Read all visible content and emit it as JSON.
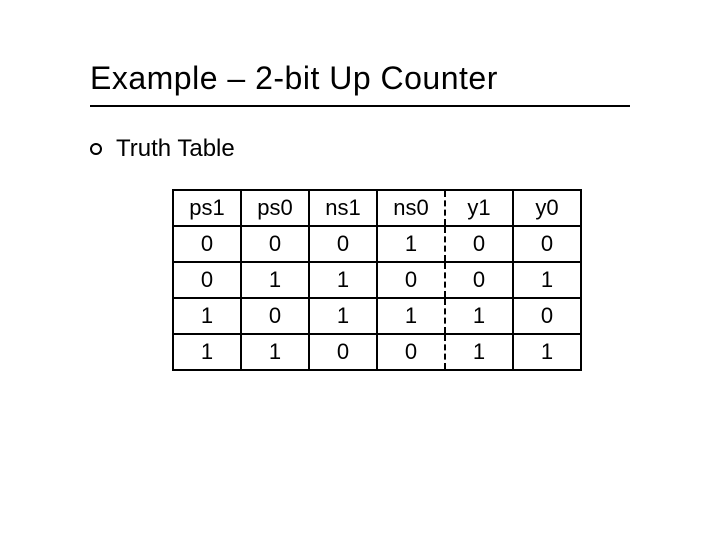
{
  "title": "Example – 2-bit Up Counter",
  "bullet": "Truth Table",
  "chart_data": {
    "type": "table",
    "headers": [
      "ps1",
      "ps0",
      "ns1",
      "ns0",
      "y1",
      "y0"
    ],
    "rows": [
      [
        "0",
        "0",
        "0",
        "1",
        "0",
        "0"
      ],
      [
        "0",
        "1",
        "1",
        "0",
        "0",
        "1"
      ],
      [
        "1",
        "0",
        "1",
        "1",
        "1",
        "0"
      ],
      [
        "1",
        "1",
        "0",
        "0",
        "1",
        "1"
      ]
    ]
  }
}
